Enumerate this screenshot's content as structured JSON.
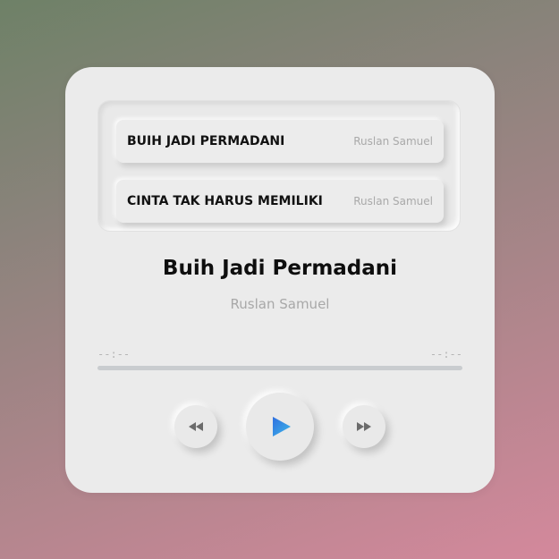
{
  "playlist": {
    "tracks": [
      {
        "title": "BUIH JADI PERMADANI",
        "artist": "Ruslan Samuel"
      },
      {
        "title": "CINTA TAK HARUS MEMILIKI",
        "artist": "Ruslan Samuel"
      }
    ]
  },
  "now_playing": {
    "title": "Buih Jadi Permadani",
    "artist": "Ruslan Samuel"
  },
  "progress": {
    "current_time": "--:--",
    "duration": "--:--",
    "fraction": 0
  },
  "controls": {
    "prev_icon": "rewind-icon",
    "play_icon": "play-icon",
    "next_icon": "fast-forward-icon"
  },
  "colors": {
    "play_gradient_start": "#2f6fe0",
    "play_gradient_end": "#3fb8e8",
    "control_icon": "#6b6b6b"
  }
}
